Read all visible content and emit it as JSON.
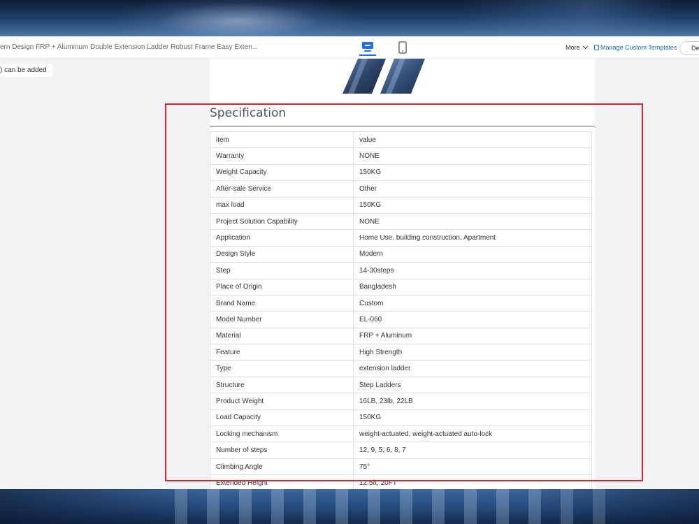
{
  "toolbar": {
    "doc_title": "ern Design FRP + Aluminum Double Extension Ladder Robust Frame Easy Exten...",
    "device_desktop": "desktop-icon",
    "device_mobile": "mobile-icon",
    "more_label": "More",
    "manage_label": "Manage Custom Templates",
    "pill_label": "De"
  },
  "note": {
    "text": ") can be added"
  },
  "spec": {
    "title": "Specification",
    "rows": [
      {
        "k": "item",
        "v": "value"
      },
      {
        "k": "Warranty",
        "v": "NONE"
      },
      {
        "k": "Weight Capacity",
        "v": "150KG"
      },
      {
        "k": "After-sale Service",
        "v": "Other"
      },
      {
        "k": "max load",
        "v": "150KG"
      },
      {
        "k": "Project Solution Capability",
        "v": "NONE"
      },
      {
        "k": "Application",
        "v": "Home Use, building construction, Apartment"
      },
      {
        "k": "Design Style",
        "v": "Modern"
      },
      {
        "k": "Step",
        "v": "14-30steps"
      },
      {
        "k": "Place of Origin",
        "v": "Bangladesh"
      },
      {
        "k": "Brand Name",
        "v": "Custom"
      },
      {
        "k": "Model Number",
        "v": "EL-060"
      },
      {
        "k": "Material",
        "v": "FRP + Aluminum"
      },
      {
        "k": "Feature",
        "v": "High Strength"
      },
      {
        "k": "Type",
        "v": "extension ladder"
      },
      {
        "k": "Structure",
        "v": "Step Ladders"
      },
      {
        "k": "Product Weight",
        "v": "16LB, 23lb, 22LB"
      },
      {
        "k": "Load Capacity",
        "v": "150KG"
      },
      {
        "k": "Locking mechanism",
        "v": "weight-actuated, weight-actuated auto-lock"
      },
      {
        "k": "Number of steps",
        "v": "12, 9, 5, 6, 8, 7"
      },
      {
        "k": "Climbing Angle",
        "v": "75°"
      },
      {
        "k": "Extended Height",
        "v": "12.5ft, 20FT"
      }
    ]
  },
  "colors": {
    "accent": "#1e6fe0",
    "highlight": "#d8262a"
  }
}
